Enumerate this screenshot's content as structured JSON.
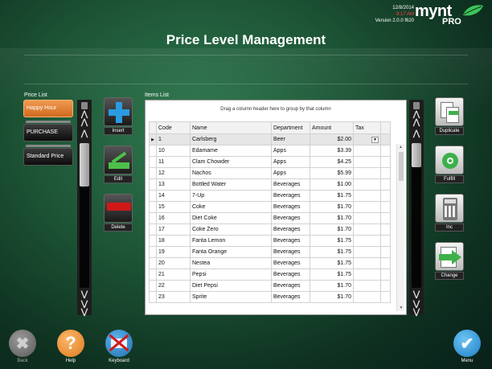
{
  "header": {
    "date": "12/8/2014",
    "time": "9:17 AM",
    "version": "Version 2.0.0 f620",
    "logo_word": "mynt",
    "logo_sub": "PRO",
    "title": "Price Level Management"
  },
  "price_list": {
    "label": "Price List",
    "items": [
      "Happy Hour",
      "PURCHASE",
      "Standard Price"
    ],
    "selected_index": 0
  },
  "actions": {
    "insert": "Insert",
    "edit": "Edit",
    "delete": "Delete"
  },
  "items_list": {
    "label": "Items List",
    "group_hint": "Drag a column header here to group by that column",
    "columns": [
      "Code",
      "Name",
      "Department",
      "Amount",
      "Tax"
    ],
    "rows": [
      [
        "1",
        "Carlsberg",
        "Beer",
        "$2.00"
      ],
      [
        "10",
        "Edamame",
        "Apps",
        "$3.39"
      ],
      [
        "11",
        "Clam Chowder",
        "Apps",
        "$4.25"
      ],
      [
        "12",
        "Nachos",
        "Apps",
        "$5.99"
      ],
      [
        "13",
        "Bottled Water",
        "Beverages",
        "$1.00"
      ],
      [
        "14",
        "7-Up",
        "Beverages",
        "$1.75"
      ],
      [
        "15",
        "Coke",
        "Beverages",
        "$1.70"
      ],
      [
        "16",
        "Diet Coke",
        "Beverages",
        "$1.70"
      ],
      [
        "17",
        "Coke Zero",
        "Beverages",
        "$1.70"
      ],
      [
        "18",
        "Fanta Lemon",
        "Beverages",
        "$1.75"
      ],
      [
        "19",
        "Fanta Orange",
        "Beverages",
        "$1.75"
      ],
      [
        "20",
        "Nestea",
        "Beverages",
        "$1.75"
      ],
      [
        "21",
        "Pepsi",
        "Beverages",
        "$1.75"
      ],
      [
        "22",
        "Diet Pepsi",
        "Beverages",
        "$1.70"
      ],
      [
        "23",
        "Sprite",
        "Beverages",
        "$1.70"
      ]
    ]
  },
  "side_actions": {
    "duplicate": "Duplicate",
    "fulfill": "Fulfill",
    "inc": "Inc",
    "change": "Change"
  },
  "bottom": {
    "back": "Back",
    "help": "Help",
    "keyboard": "Keyboard",
    "menu": "Menu"
  },
  "colors": {
    "accent_orange": "#e07a30",
    "accent_green": "#2ea84a",
    "accent_blue": "#2a9be0",
    "danger_red": "#d01818"
  }
}
